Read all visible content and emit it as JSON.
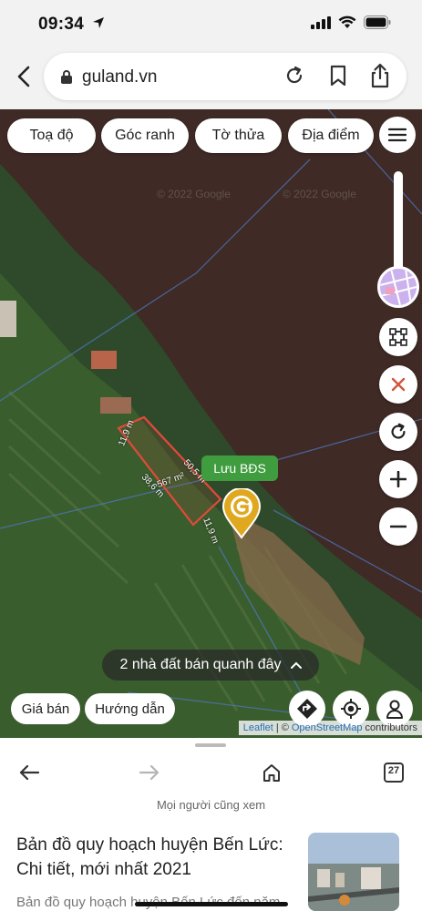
{
  "status": {
    "time": "09:34"
  },
  "browser": {
    "url": "guland.vn"
  },
  "map": {
    "chips": [
      "Toạ độ",
      "Góc ranh",
      "Tờ thửa",
      "Địa điểm"
    ],
    "watermarks": [
      "© 2022 Google",
      "© 2022 Google"
    ],
    "measurements": {
      "top": "11,9 m",
      "right": "50,5 m",
      "left": "38,6 m",
      "area": "567 m²",
      "bottom": "11,9 m"
    },
    "save_label": "Lưu BĐS",
    "nearby_label": "2 nhà đất bán quanh đây",
    "bottom_chips": [
      "Giá bán",
      "Hướng dẫn"
    ],
    "attribution": {
      "leaflet": "Leaflet",
      "sep": "| ©",
      "osm": "OpenStreetMap",
      "contrib": "contributors"
    },
    "icons": [
      "menu-icon",
      "layers-icon",
      "select-area-icon",
      "close-icon",
      "refresh-icon",
      "zoom-in-icon",
      "zoom-out-icon",
      "directions-icon",
      "locate-icon",
      "person-icon",
      "marker-icon"
    ]
  },
  "page": {
    "see_also": "Mọi người cũng xem",
    "article_title": "Bản đồ quy hoạch huyện Bến Lức: Chi tiết, mới nhất 2021",
    "article_snippet": "Bản đồ quy hoạch huyện Bến Lức đến năm",
    "tab_count": "27"
  },
  "colors": {
    "save_green": "#3f9d3f",
    "parcel_red": "#e24a3b",
    "marker_gold": "#e0a81e"
  }
}
